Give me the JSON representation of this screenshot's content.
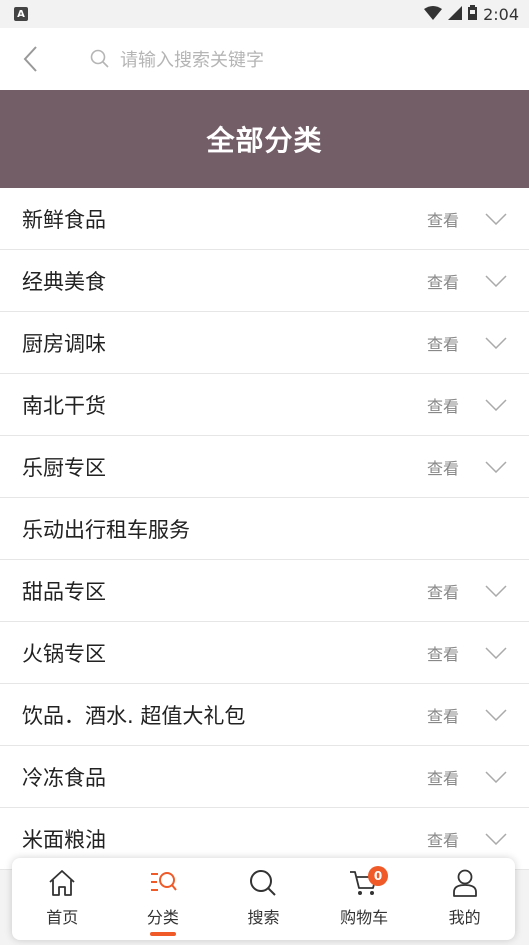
{
  "status_bar": {
    "time": "2:04",
    "left_icon": "A"
  },
  "search": {
    "placeholder": "请输入搜索关键字"
  },
  "banner": {
    "title": "全部分类"
  },
  "view_label": "查看",
  "categories": [
    {
      "label": "新鲜食品",
      "has_view": true
    },
    {
      "label": "经典美食",
      "has_view": true
    },
    {
      "label": "厨房调味",
      "has_view": true
    },
    {
      "label": "南北干货",
      "has_view": true
    },
    {
      "label": "乐厨专区",
      "has_view": true
    },
    {
      "label": "乐动出行租车服务",
      "has_view": false
    },
    {
      "label": "甜品专区",
      "has_view": true
    },
    {
      "label": "火锅专区",
      "has_view": true
    },
    {
      "label": "饮品．酒水. 超值大礼包",
      "has_view": true
    },
    {
      "label": "冷冻食品",
      "has_view": true
    },
    {
      "label": "米面粮油",
      "has_view": true
    }
  ],
  "tabbar": {
    "home": "首页",
    "category": "分类",
    "search": "搜索",
    "cart": "购物车",
    "cart_count": "0",
    "mine": "我的"
  },
  "colors": {
    "banner": "#735e68",
    "accent": "#f05a28"
  }
}
